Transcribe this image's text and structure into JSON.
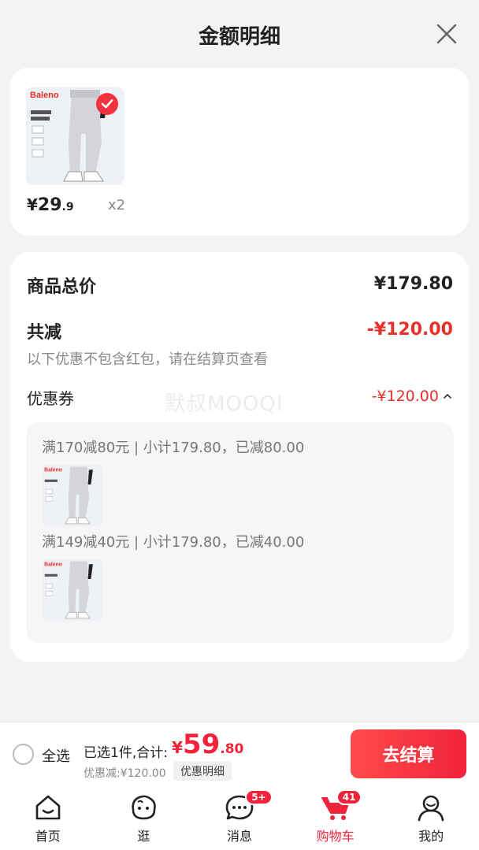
{
  "sheet": {
    "title": "金额明细"
  },
  "product": {
    "brand": "Baleno",
    "price_currency": "¥",
    "price_int": "29",
    "price_dec": ".9",
    "quantity": "x2"
  },
  "summary": {
    "total_label": "商品总价",
    "total_value": "¥179.80",
    "reduce_label": "共减",
    "reduce_value": "-¥120.00",
    "note": "以下优惠不包含红包，请在结算页查看",
    "coupon_label": "优惠券",
    "coupon_value": "-¥120.00",
    "watermark": "默叔MOOQI",
    "coupon_lines": [
      "满170减80元 | 小计179.80，已减80.00",
      "满149减40元 | 小计179.80，已减40.00"
    ]
  },
  "footer": {
    "select_all": "全选",
    "selected_text": "已选1件,合计:",
    "total_currency": "¥",
    "total_int": "59",
    "total_dec": ".80",
    "discount_text": "优惠减:¥120.00",
    "detail_chip": "优惠明细",
    "checkout": "去结算"
  },
  "tabs": [
    {
      "label": "首页",
      "icon": "home-icon"
    },
    {
      "label": "逛",
      "icon": "smile-face-icon"
    },
    {
      "label": "消息",
      "icon": "message-icon",
      "badge": "5+"
    },
    {
      "label": "购物车",
      "icon": "cart-icon",
      "badge": "41",
      "active": true
    },
    {
      "label": "我的",
      "icon": "profile-icon"
    }
  ],
  "colors": {
    "accent": "#f0233b",
    "reduce": "#e8302c",
    "bg": "#f3f3f3"
  }
}
